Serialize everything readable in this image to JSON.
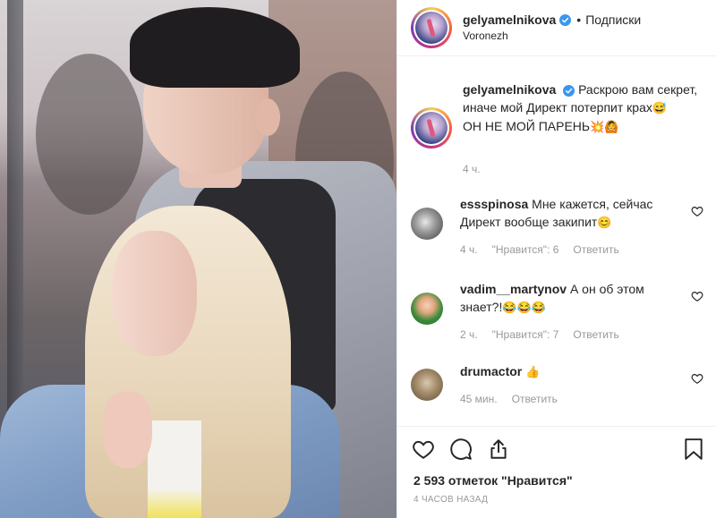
{
  "header": {
    "username": "gelyamelnikova",
    "separator": "•",
    "follow_label": "Подписки",
    "location": "Voronezh"
  },
  "caption": {
    "username": "gelyamelnikova",
    "text_line1": "Раскрою вам секрет, иначе мой Директ потерпит крах",
    "emoji1": "😅",
    "text_line2": "ОН НЕ МОЙ ПАРЕНЬ",
    "emoji2": "💥🙆",
    "time": "4 ч."
  },
  "comments": [
    {
      "username": "essspinosa",
      "text": "Мне кажется, сейчас Директ вообще закипит",
      "emoji": "😊",
      "time": "4 ч.",
      "likes": "\"Нравится\": 6",
      "reply": "Ответить"
    },
    {
      "username": "vadim__martynov",
      "text": "А он об этом знает?!",
      "emoji": "😂😂😂",
      "time": "2 ч.",
      "likes": "\"Нравится\": 7",
      "reply": "Ответить"
    },
    {
      "username": "drumactor",
      "text": "",
      "emoji": "👍",
      "time": "45 мин.",
      "likes": "",
      "reply": "Ответить"
    }
  ],
  "footer": {
    "likes_count": "2 593 отметок \"Нравится\"",
    "posted": "4 ЧАСОВ НАЗАД"
  },
  "icons": {
    "like": "heart-icon",
    "comment": "comment-icon",
    "share": "share-icon",
    "save": "bookmark-icon",
    "verified": "verified-badge-icon"
  },
  "colors": {
    "verified": "#3897f0",
    "text": "#262626",
    "meta": "#999999",
    "divider": "#efefef"
  }
}
